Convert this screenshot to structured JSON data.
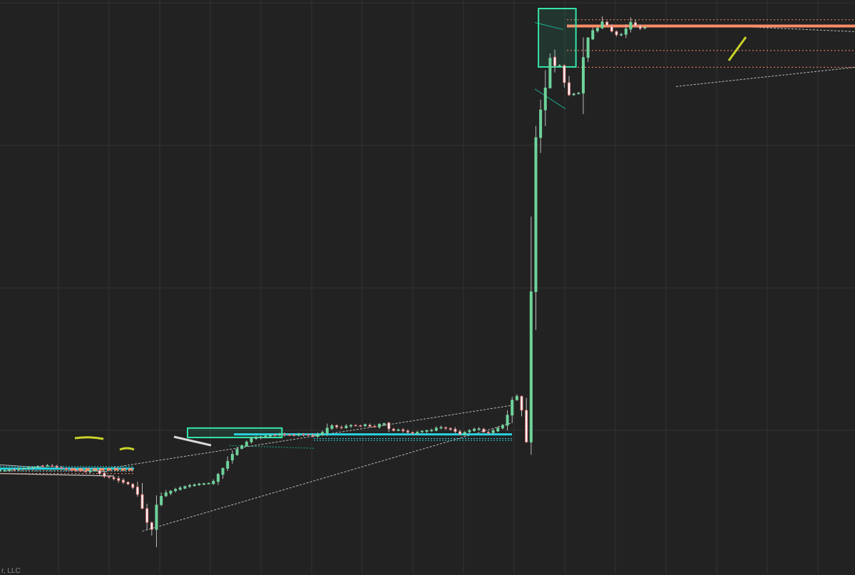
{
  "footer": {
    "text": "r, LLC"
  },
  "colors": {
    "background": "#222222",
    "grid": "#333333",
    "bull": "#6ed39a",
    "bear": "#e06a6a",
    "wick": "#bdbdbd",
    "trend": "#b9b9b9",
    "resistance": "#ff8c66",
    "support_cyan": "#29d3e0",
    "box": "#35e6a6",
    "annotation_yellow": "#cbd32a"
  },
  "chart_data": {
    "type": "candlestick",
    "grid": true,
    "candle_count": 137,
    "closes": [
      1050,
      1049,
      1051,
      1050,
      1054,
      1055,
      1057,
      1058,
      1061,
      1062,
      1063,
      1062,
      1058,
      1055,
      1052,
      1050,
      1048,
      1047,
      1046,
      1048,
      1049,
      1040,
      1032,
      1030,
      1025,
      1020,
      1015,
      1010,
      1000,
      980,
      940,
      900,
      880,
      950,
      975,
      985,
      990,
      995,
      999,
      1003,
      1006,
      1008,
      1010,
      1011,
      1012,
      1018,
      1038,
      1055,
      1075,
      1095,
      1110,
      1120,
      1130,
      1140,
      1143,
      1145,
      1147,
      1149,
      1150,
      1152,
      1150,
      1149,
      1150,
      1152,
      1151,
      1150,
      1147,
      1152,
      1158,
      1170,
      1177,
      1173,
      1171,
      1176,
      1178,
      1177,
      1176,
      1180,
      1175,
      1173,
      1181,
      1183,
      1168,
      1163,
      1165,
      1162,
      1158,
      1155,
      1158,
      1161,
      1163,
      1164,
      1170,
      1172,
      1169,
      1166,
      1160,
      1153,
      1158,
      1163,
      1167,
      1168,
      1159,
      1156,
      1163,
      1170,
      1178,
      1207,
      1250,
      1261,
      1221,
      1130,
      1560,
      2001,
      2080,
      2143,
      2228,
      2206,
      2207,
      2158,
      2123,
      2126,
      2128,
      2230,
      2286,
      2307,
      2314,
      2332,
      2322,
      2305,
      2295,
      2296,
      2312,
      2331,
      2320,
      2313,
      2316
    ],
    "overlays": {
      "resistance_levels": [
        2338,
        2320,
        2250,
        2202
      ],
      "support_levels": [
        1152,
        1054,
        1047
      ],
      "trendlines": [
        {
          "from": {
            "candle": 30,
            "price": 875
          },
          "to": {
            "candle": 108,
            "price": 1185
          }
        },
        {
          "from": {
            "candle": 18,
            "price": 1045
          },
          "to": {
            "candle": 108,
            "price": 1235
          }
        }
      ],
      "consolidation_boxes": [
        {
          "candle_start": 40,
          "candle_end": 59,
          "price_low": 1143,
          "price_high": 1170
        },
        {
          "candle_start": 114,
          "candle_end": 121,
          "price_low": 2203,
          "price_high": 2370
        }
      ]
    }
  }
}
